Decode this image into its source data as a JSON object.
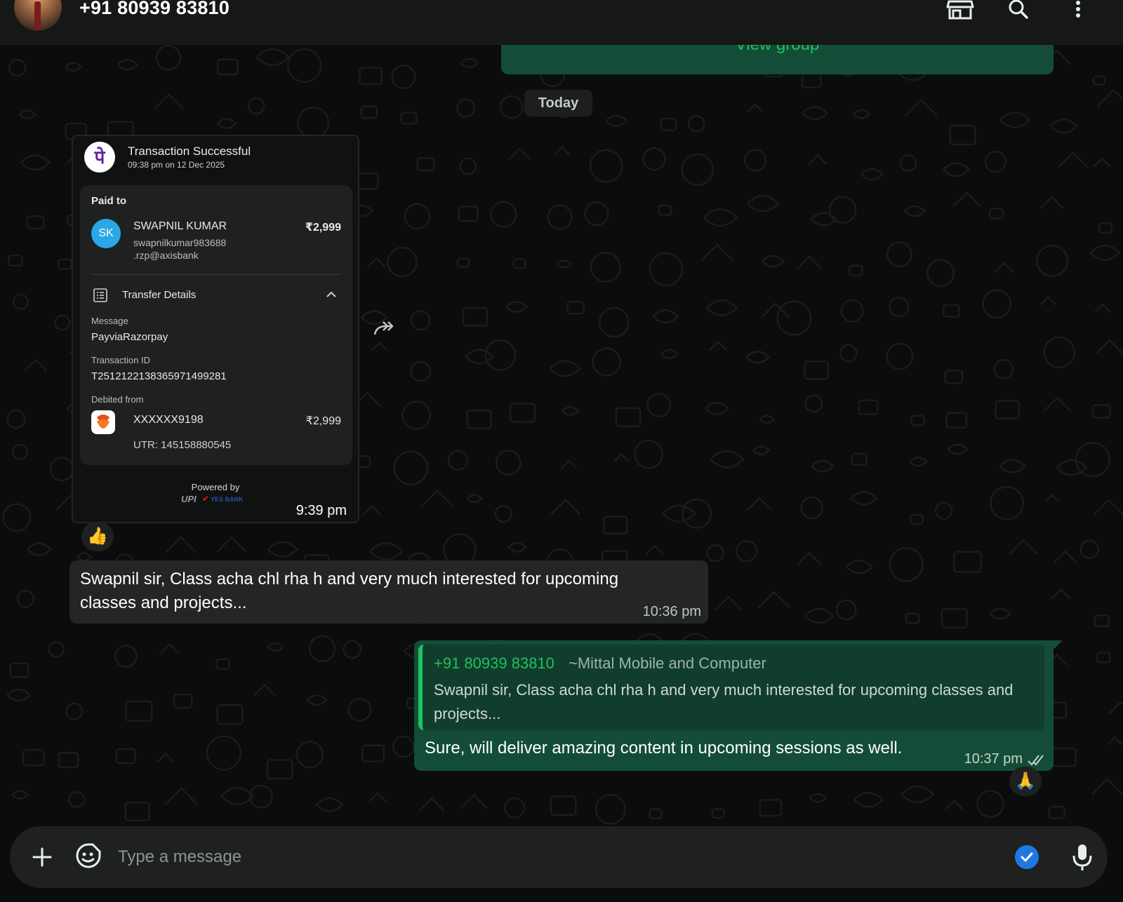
{
  "header": {
    "contact_name": "+91 80939 83810",
    "icons": [
      "store-icon",
      "search-icon",
      "more-vertical-icon"
    ]
  },
  "group_banner": {
    "label": "View group"
  },
  "date_divider": "Today",
  "payment_card": {
    "title": "Transaction Successful",
    "subtitle": "09:38 pm on 12 Dec 2025",
    "logo_glyph": "पे",
    "paid_to_label": "Paid to",
    "payee_initials": "SK",
    "payee_name": "SWAPNIL KUMAR",
    "payee_vpa_line1": "swapnilkumar983688",
    "payee_vpa_line2": ".rzp@axisbank",
    "amount": "₹2,999",
    "transfer_details_label": "Transfer Details",
    "message_label": "Message",
    "message_value": "PayviaRazorpay",
    "txn_id_label": "Transaction ID",
    "txn_id_value": "T2512122138365971499281",
    "debited_from_label": "Debited from",
    "account": "XXXXXX9198",
    "debit_amount": "₹2,999",
    "utr": "UTR: 145158880545",
    "powered_by": "Powered by",
    "upi_text": "UPI",
    "bank_text": "YES BANK",
    "time": "9:39 pm",
    "reaction": "👍"
  },
  "incoming_message": {
    "text": "Swapnil sir, Class acha chl rha h and very much interested for upcoming classes and projects...",
    "time": "10:36 pm"
  },
  "outgoing_message": {
    "quote_author": "+91 80939 83810",
    "quote_author_sub": "~Mittal Mobile and Computer",
    "quote_text": "Swapnil sir, Class acha chl rha h and very much interested for upcoming classes and projects...",
    "text": "Sure, will deliver amazing content in upcoming sessions as well.",
    "time": "10:37 pm",
    "reaction": "🙏"
  },
  "composer": {
    "placeholder": "Type a message"
  },
  "colors": {
    "app_bg": "#0b0c0c",
    "header_bg": "#161717",
    "incoming_bubble": "#242626",
    "outgoing_bubble": "#144d37",
    "accent_green": "#21c063",
    "check_blue": "#1f78e3"
  }
}
